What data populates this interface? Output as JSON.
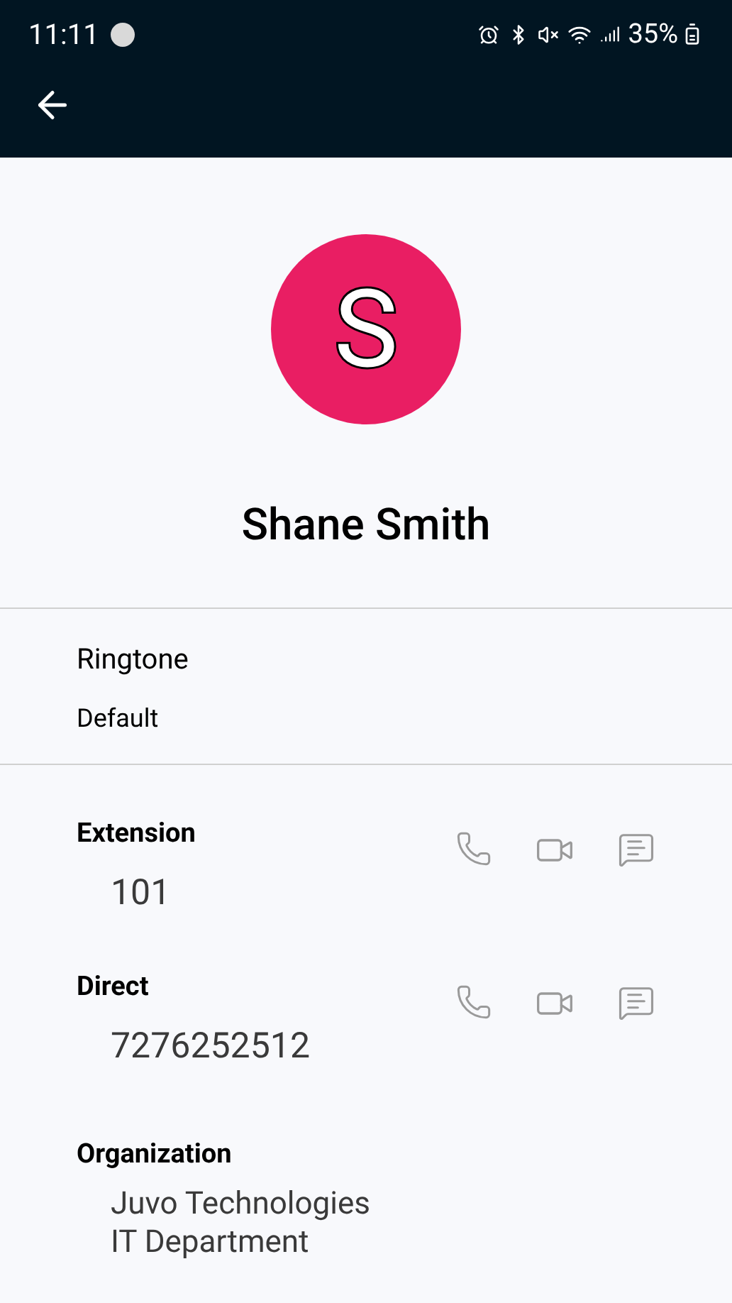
{
  "status_bar": {
    "time": "11:11",
    "battery": "35%"
  },
  "contact": {
    "initial": "S",
    "name": "Shane Smith"
  },
  "ringtone": {
    "label": "Ringtone",
    "value": "Default"
  },
  "numbers": [
    {
      "label": "Extension",
      "value": "101"
    },
    {
      "label": "Direct",
      "value": "7276252512"
    }
  ],
  "organization": {
    "label": "Organization",
    "lines": [
      "Juvo Technologies",
      "IT Department"
    ]
  }
}
